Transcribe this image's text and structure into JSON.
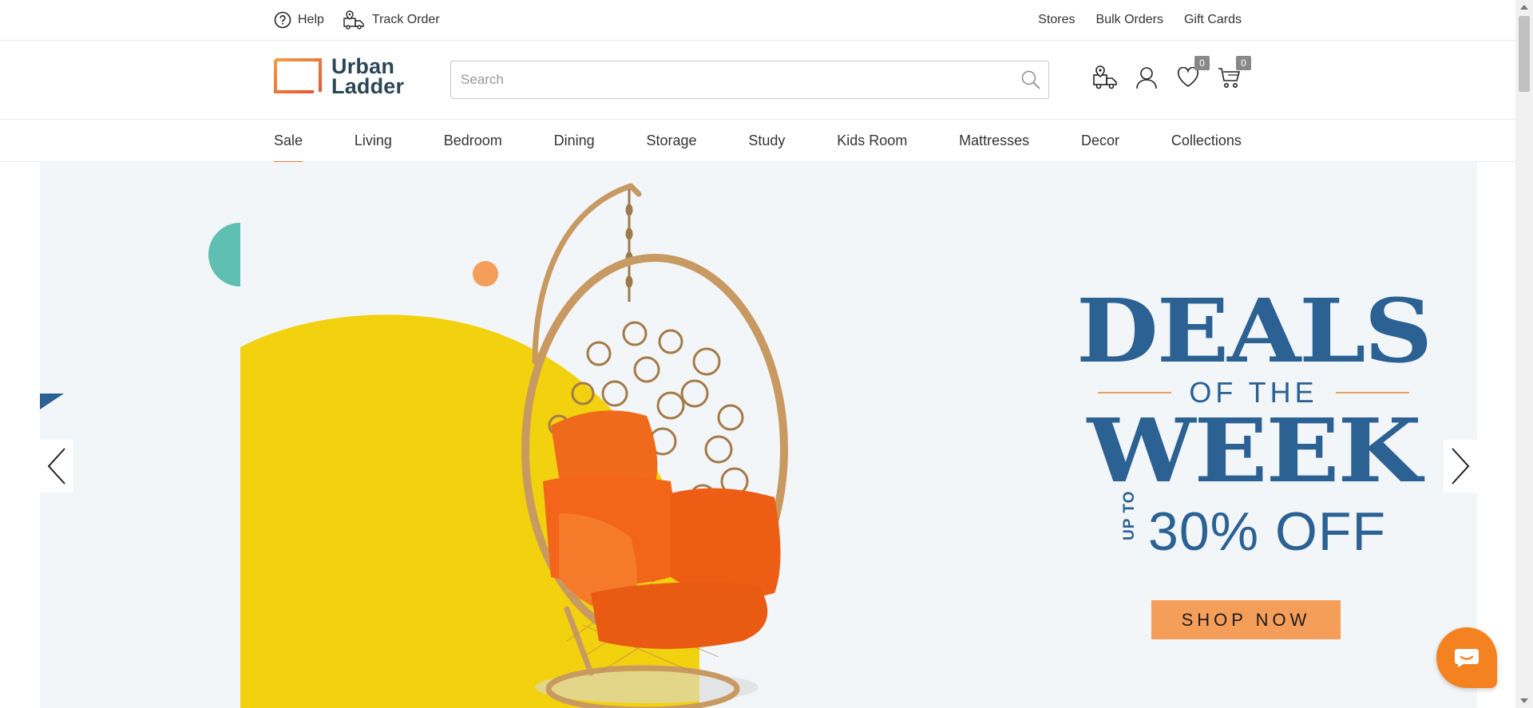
{
  "topbar": {
    "help": {
      "label": "Help",
      "icon": "help-circle-icon"
    },
    "track_order": {
      "label": "Track Order",
      "icon": "truck-icon"
    },
    "right_links": [
      "Stores",
      "Bulk Orders",
      "Gift Cards"
    ]
  },
  "header": {
    "logo": {
      "line1": "Urban",
      "line2": "Ladder"
    },
    "search": {
      "placeholder": "Search",
      "value": ""
    },
    "wishlist_count": "0",
    "cart_count": "0"
  },
  "nav": {
    "items": [
      "Sale",
      "Living",
      "Bedroom",
      "Dining",
      "Storage",
      "Study",
      "Kids Room",
      "Mattresses",
      "Decor",
      "Collections"
    ],
    "active": "Sale"
  },
  "hero": {
    "headline_1": "DEALS",
    "headline_2": "OF THE",
    "headline_3": "WEEK",
    "upto": "UP TO",
    "offer": "30% OFF",
    "cta": "SHOP NOW"
  },
  "colors": {
    "brand_orange": "#f07d3e",
    "deal_blue": "#2b6193",
    "hero_yellow": "#f2d10f",
    "cta_orange": "#f59e5a",
    "teal": "#5fbfb0",
    "hero_bg": "#f3f6f9"
  }
}
